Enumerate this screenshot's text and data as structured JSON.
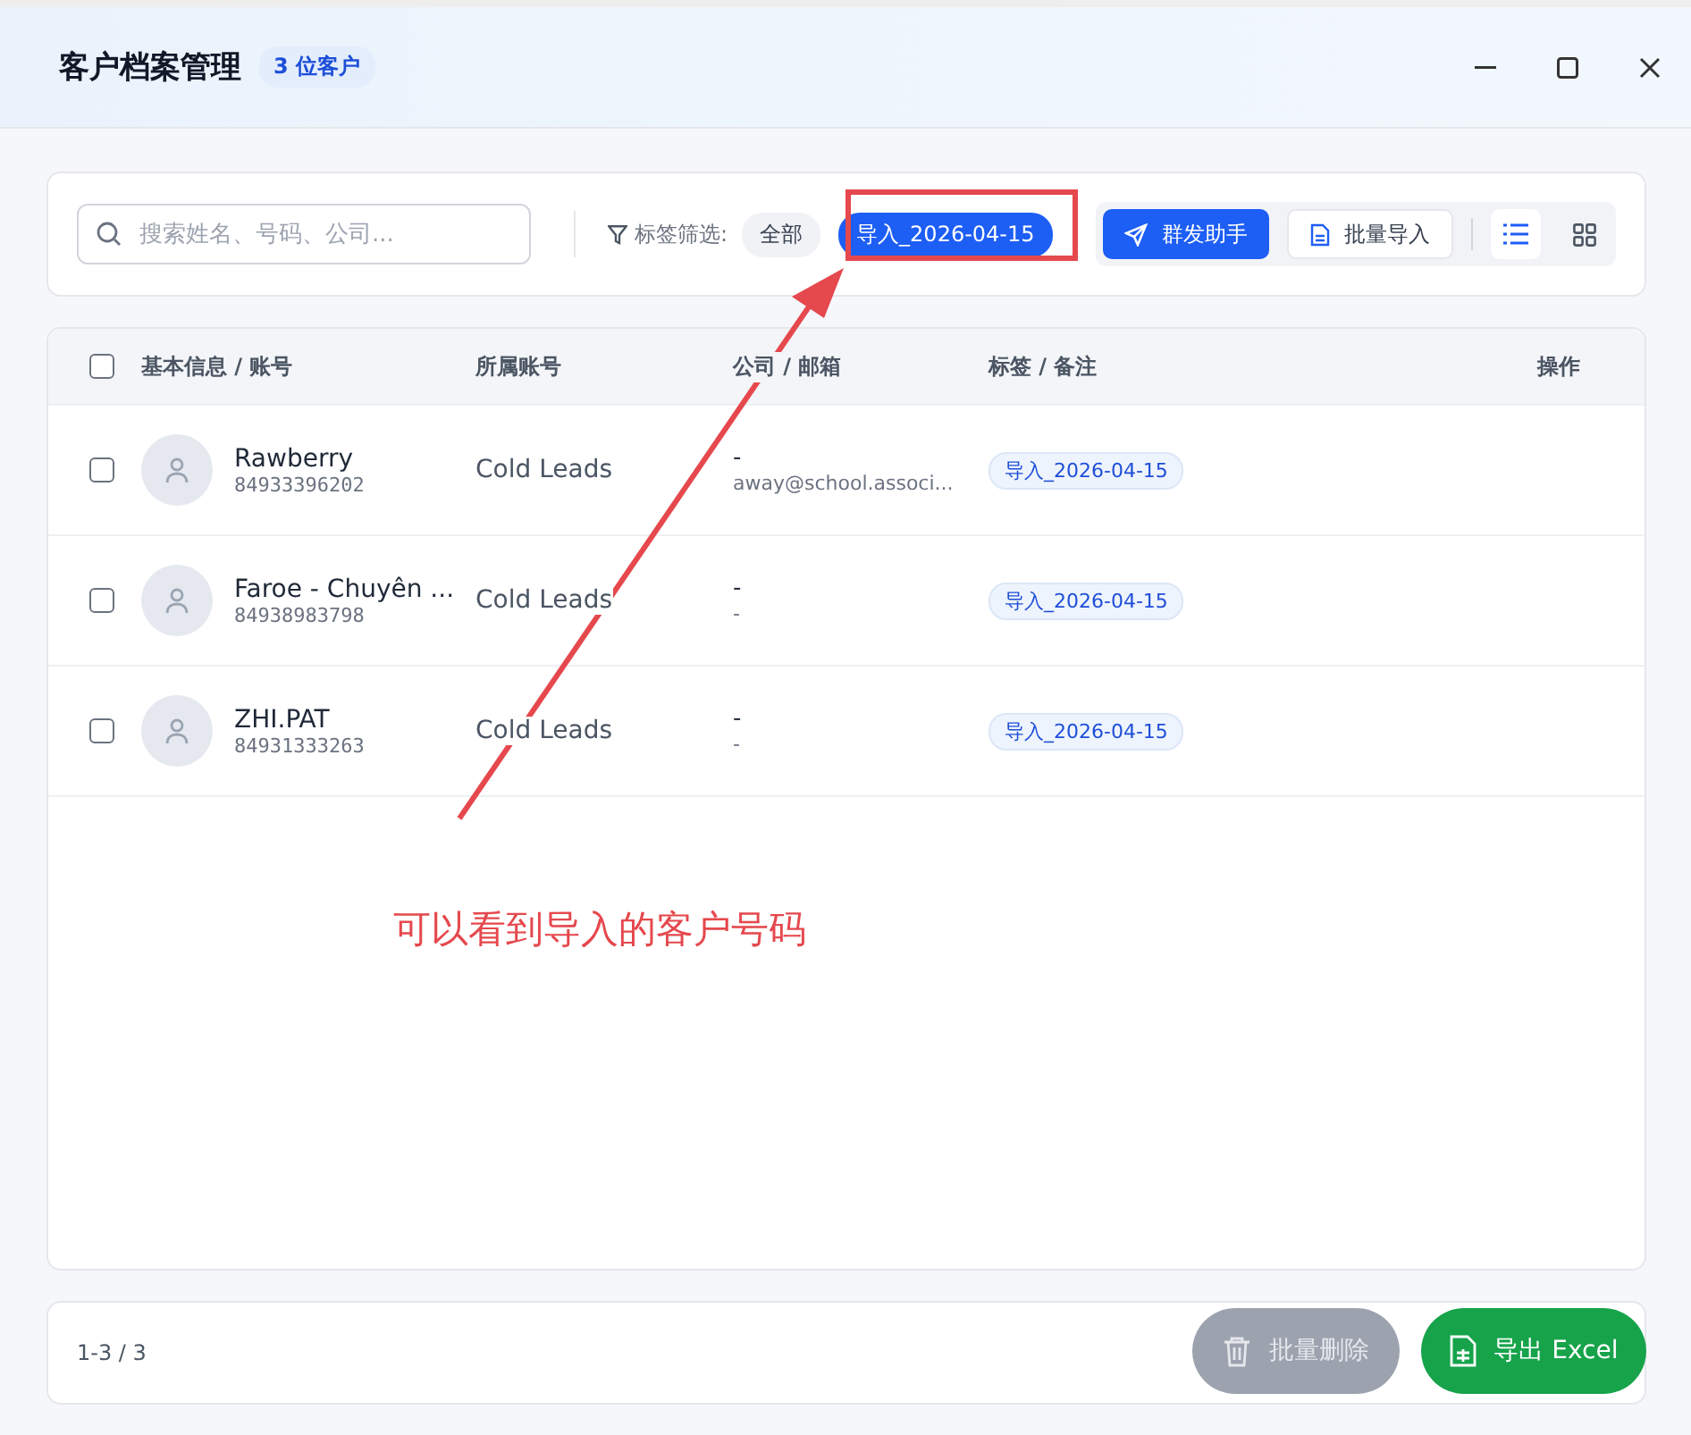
{
  "window": {
    "title": "客户档案管理",
    "badge": "3 位客户"
  },
  "toolbar": {
    "search_placeholder": "搜索姓名、号码、公司...",
    "filter_label": "标签筛选:",
    "filters": [
      {
        "label": "全部",
        "selected": false
      },
      {
        "label": "导入_2026-04-15",
        "selected": true
      }
    ],
    "broadcast_button": "群发助手",
    "import_button": "批量导入",
    "view_modes": [
      {
        "kind": "list",
        "selected": true
      },
      {
        "kind": "grid",
        "selected": false
      }
    ]
  },
  "table": {
    "columns": [
      "基本信息 / 账号",
      "所属账号",
      "公司 / 邮箱",
      "标签 / 备注",
      "操作"
    ],
    "select_all_checked": false,
    "rows": [
      {
        "checked": false,
        "name": "Rawberry",
        "phone": "84933396202",
        "account": "Cold Leads",
        "company": "-",
        "email": "away@school.associ...",
        "tag": "导入_2026-04-15"
      },
      {
        "checked": false,
        "name": "Faroe - Chuyên ...",
        "phone": "84938983798",
        "account": "Cold Leads",
        "company": "-",
        "email": "-",
        "tag": "导入_2026-04-15"
      },
      {
        "checked": false,
        "name": "ZHI.PAT",
        "phone": "84931333263",
        "account": "Cold Leads",
        "company": "-",
        "email": "-",
        "tag": "导入_2026-04-15"
      }
    ]
  },
  "footer": {
    "range": "1-3 / 3",
    "delete_button": {
      "label": "批量删除",
      "disabled": true
    },
    "export_button": "导出 Excel"
  },
  "annotation": {
    "text": "可以看到导入的客户号码"
  }
}
